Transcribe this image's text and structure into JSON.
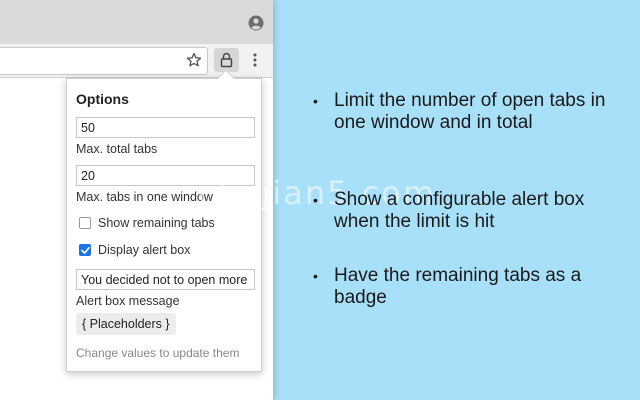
{
  "popup": {
    "title": "Options",
    "max_total_tabs": {
      "value": "50",
      "label": "Max. total tabs"
    },
    "max_tabs_window": {
      "value": "20",
      "label": "Max. tabs in one window"
    },
    "show_remaining": {
      "label": "Show remaining tabs",
      "checked": false
    },
    "display_alert": {
      "label": "Display alert box",
      "checked": true
    },
    "alert_message": {
      "value": "You decided not to open more",
      "label": "Alert box message"
    },
    "placeholders_label": "{ Placeholders }",
    "hint": "Change values to update them"
  },
  "features": [
    "Limit the number of open tabs in one window and in total",
    "Show a configurable alert box when the limit is hit",
    "Have the remaining tabs as a badge"
  ],
  "bullet": "•",
  "watermark": "chajian5.com",
  "icons": {
    "profile": "account-circle-icon",
    "star": "star-outline-icon",
    "extension": "lock-icon",
    "menu": "three-dot-menu-icon"
  },
  "colors": {
    "background": "#a9e0f9",
    "checkbox_accent": "#1a73e8"
  }
}
